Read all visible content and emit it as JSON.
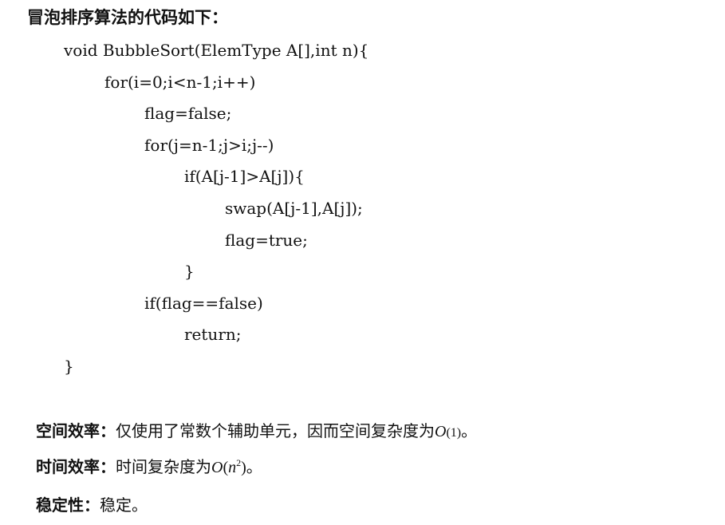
{
  "heading": "冒泡排序算法的代码如下：",
  "code": {
    "lines": [
      "void BubbleSort(ElemType A[],int n){",
      "for(i=0;i<n-1;i++)",
      "flag=false;",
      "for(j=n-1;j>i;j--)",
      "if(A[j-1]>A[j]){",
      "swap(A[j-1],A[j]);",
      "flag=true;",
      "}",
      "if(flag==false)",
      "return;",
      "}"
    ]
  },
  "notes": {
    "space": {
      "label": "空间效率：",
      "text": "仅使用了常数个辅助单元，因而空间复杂度为",
      "complexity_O": "O",
      "complexity_open": "(",
      "complexity_value": "1",
      "complexity_close": ")",
      "tail": "。"
    },
    "time": {
      "label": "时间效率：",
      "text": "时间复杂度为",
      "complexity_O": "O",
      "complexity_open": "(",
      "complexity_var": "n",
      "complexity_exp": "2",
      "complexity_close": ")",
      "tail": "。"
    },
    "stability": {
      "label": "稳定性：",
      "text": "稳定。"
    }
  }
}
